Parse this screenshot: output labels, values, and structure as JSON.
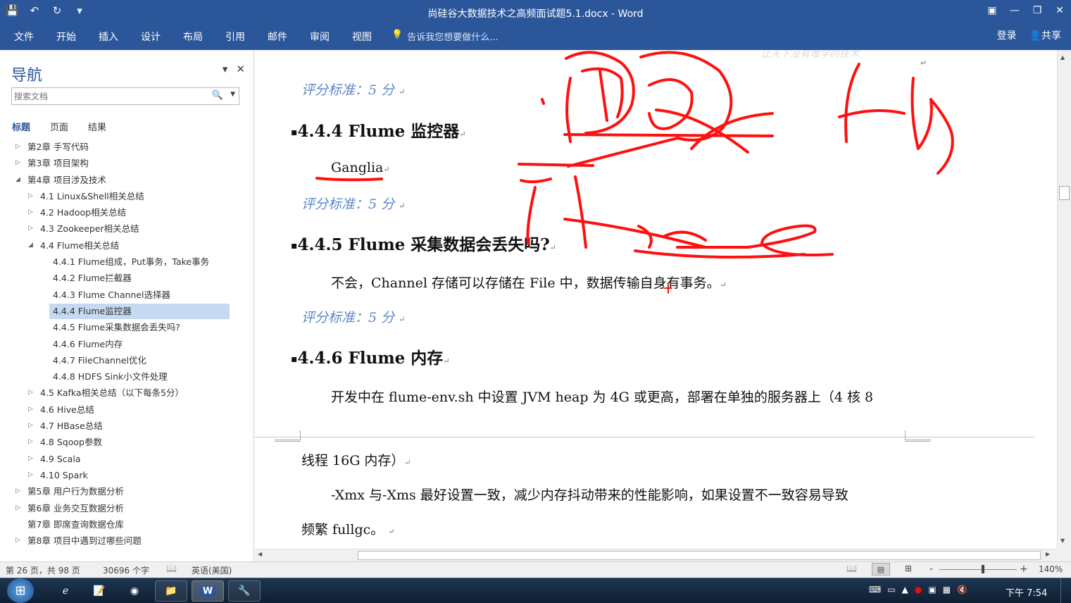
{
  "window": {
    "title": "尚硅谷大数据技术之高频面试题5.1.docx - Word",
    "buttons": {
      "ribbon_display": "▣",
      "minimize": "—",
      "restore": "❐",
      "close": "✕"
    }
  },
  "qat": {
    "save": "💾",
    "undo": "↶",
    "redo": "↻",
    "more": "▾"
  },
  "ribbon": {
    "tabs": [
      "文件",
      "开始",
      "插入",
      "设计",
      "布局",
      "引用",
      "邮件",
      "审阅",
      "视图"
    ],
    "tell_me": "告诉我您想要做什么...",
    "login": "登录",
    "share": "共享"
  },
  "nav": {
    "title": "导航",
    "search_placeholder": "搜索文档",
    "tabs": [
      "标题",
      "页面",
      "结果"
    ],
    "items": [
      {
        "label": "第2章 手写代码",
        "level": 0,
        "arrow": "▷"
      },
      {
        "label": "第3章 项目架构",
        "level": 0,
        "arrow": "▷"
      },
      {
        "label": "第4章 项目涉及技术",
        "level": 0,
        "arrow": "◢"
      },
      {
        "label": "4.1 Linux&Shell相关总结",
        "level": 1,
        "arrow": "▷"
      },
      {
        "label": "4.2 Hadoop相关总结",
        "level": 1,
        "arrow": "▷"
      },
      {
        "label": "4.3 Zookeeper相关总结",
        "level": 1,
        "arrow": "▷"
      },
      {
        "label": "4.4 Flume相关总结",
        "level": 1,
        "arrow": "◢"
      },
      {
        "label": "4.4.1 Flume组成，Put事务，Take事务",
        "level": 2,
        "arrow": ""
      },
      {
        "label": "4.4.2 Flume拦截器",
        "level": 2,
        "arrow": ""
      },
      {
        "label": "4.4.3 Flume Channel选择器",
        "level": 2,
        "arrow": ""
      },
      {
        "label": "4.4.4 Flume监控器",
        "level": 2,
        "arrow": "",
        "selected": true
      },
      {
        "label": "4.4.5 Flume采集数据会丢失吗?",
        "level": 2,
        "arrow": ""
      },
      {
        "label": "4.4.6 Flume内存",
        "level": 2,
        "arrow": ""
      },
      {
        "label": "4.4.7 FileChannel优化",
        "level": 2,
        "arrow": ""
      },
      {
        "label": "4.4.8 HDFS Sink小文件处理",
        "level": 2,
        "arrow": ""
      },
      {
        "label": "4.5 Kafka相关总结（以下每条5分）",
        "level": 1,
        "arrow": "▷"
      },
      {
        "label": "4.6 Hive总结",
        "level": 1,
        "arrow": "▷"
      },
      {
        "label": "4.7 HBase总结",
        "level": 1,
        "arrow": "▷"
      },
      {
        "label": "4.8 Sqoop参数",
        "level": 1,
        "arrow": "▷"
      },
      {
        "label": "4.9 Scala",
        "level": 1,
        "arrow": "▷"
      },
      {
        "label": "4.10 Spark",
        "level": 1,
        "arrow": "▷"
      },
      {
        "label": "第5章 用户行为数据分析",
        "level": 0,
        "arrow": "▷"
      },
      {
        "label": "第6章 业务交互数据分析",
        "level": 0,
        "arrow": "▷"
      },
      {
        "label": "第7章 即席查询数据仓库",
        "level": 0,
        "arrow": ""
      },
      {
        "label": "第8章 项目中遇到过哪些问题",
        "level": 0,
        "arrow": "▷"
      }
    ]
  },
  "doc": {
    "watermark": "让天下没有难学的技术",
    "score1": "评分标准：5 分",
    "h444": "4.4.4 Flume 监控器",
    "ganglia": "Ganglia",
    "score2": "评分标准：5 分",
    "h445": "4.4.5 Flume 采集数据会丢失吗?",
    "p445": "不会，Channel 存储可以存储在 File 中，数据传输自身有事务。",
    "score3": "评分标准：5 分",
    "h446": "4.4.6 Flume 内存",
    "p446a": "开发中在 flume-env.sh 中设置 JVM heap 为 4G 或更高，部署在单独的服务器上（4 核 8",
    "p446b": "线程 16G 内存）",
    "p446c": "-Xmx 与-Xms 最好设置一致，减少内存抖动带来的性能影响，如果设置不一致容易导致",
    "p446d": "频繁 fullgc。",
    "para_mark": "↵",
    "bullet": "▪"
  },
  "status": {
    "page": "第 26 页，共 98 页",
    "words": "30696 个字",
    "proof_icon": "📖",
    "language": "英语(美国)",
    "zoom_minus": "-",
    "zoom_plus": "+",
    "zoom": "140%",
    "zoom_level": 0.56
  },
  "taskbar": {
    "start": "⊞",
    "time": "下午 7:54",
    "apps": [
      "ie-icon",
      "notes-icon",
      "chrome-icon",
      "explorer-icon",
      "word-icon",
      "tool-icon"
    ]
  },
  "annotation_color": "#ff1010"
}
